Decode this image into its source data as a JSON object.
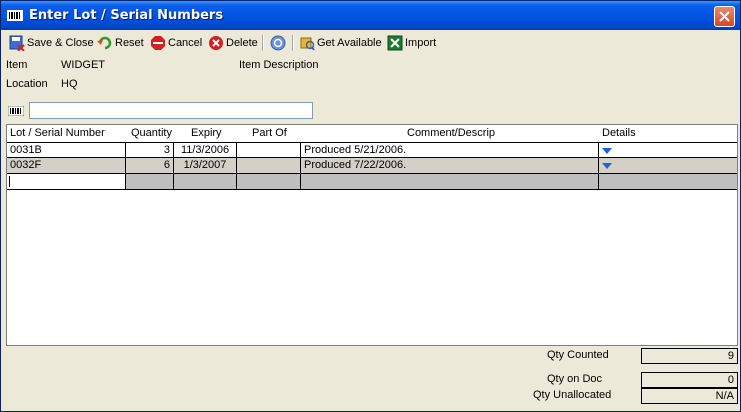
{
  "window": {
    "title": "Enter Lot / Serial Numbers"
  },
  "toolbar": {
    "save_close": "Save & Close",
    "reset": "Reset",
    "cancel": "Cancel",
    "delete": "Delete",
    "get_available": "Get Available",
    "import": "Import"
  },
  "info": {
    "item_label": "Item",
    "item_value": "WIDGET",
    "item_description_label": "Item Description",
    "location_label": "Location",
    "location_value": "HQ"
  },
  "filter": {
    "value": ""
  },
  "grid": {
    "columns": [
      "Lot / Serial Number",
      "Quantity",
      "Expiry",
      "Part Of",
      "Comment/Descrip",
      "Details"
    ],
    "rows": [
      {
        "lot": "0031B",
        "quantity": "3",
        "expiry": "11/3/2006",
        "part_of": "",
        "comment": "Produced 5/21/2006."
      },
      {
        "lot": "0032F",
        "quantity": "6",
        "expiry": "1/3/2007",
        "part_of": "",
        "comment": "Produced 7/22/2006."
      }
    ]
  },
  "summary": {
    "qty_counted_label": "Qty Counted",
    "qty_counted_value": "9",
    "qty_on_doc_label": "Qty on Doc",
    "qty_on_doc_value": "0",
    "qty_unallocated_label": "Qty Unallocated",
    "qty_unallocated_value": "N/A"
  },
  "colors": {
    "title_bar": "#0054e3",
    "window_bg": "#ece9d8",
    "row_selected": "#d4d0c8"
  }
}
